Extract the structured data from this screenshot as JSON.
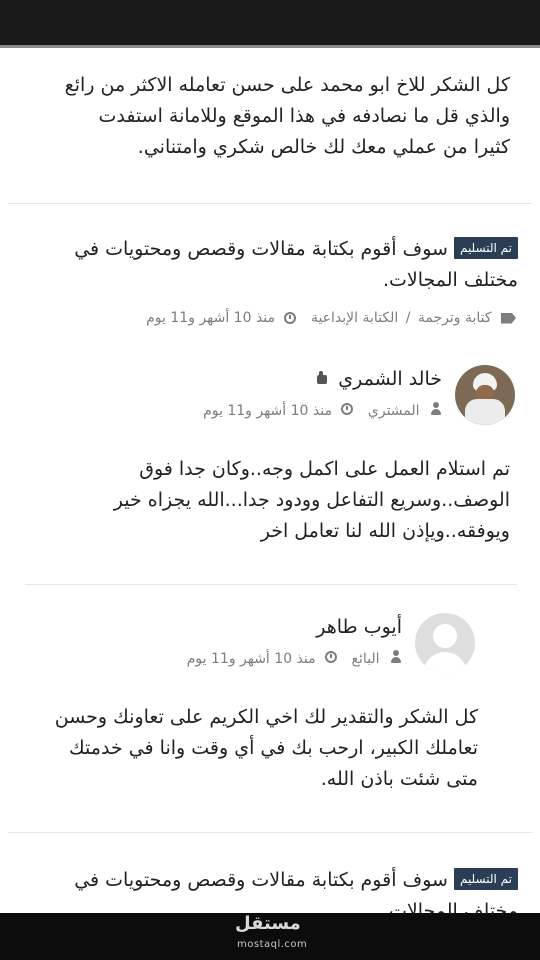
{
  "review_1": {
    "lines": [
      "كل الشكر للاخ ابو محمد على حسن تعامله الاكثر من رائع",
      "والذي قل ما نصادفه في هذا الموقع وللامانة استفدت",
      "كثيرا من عملي معك لك خالص شكري وامتناني."
    ]
  },
  "project_1": {
    "badge": "تم التسليم",
    "title_line1": "سوف أقوم بكتابة مقالات وقصص ومحتويات في",
    "title_line2": "مختلف المجالات.",
    "category": "كتابة وترجمة",
    "subcategory": "الكتابة الإبداعية",
    "separator": "/",
    "time": "منذ 10 أشهر و11 يوم"
  },
  "buyer": {
    "name": "خالد الشمري",
    "role": "المشتري",
    "time": "منذ 10 أشهر و11 يوم",
    "comment_lines": [
      "تم استلام العمل على اكمل وجه..وكان جدا فوق",
      "الوصف..وسريع التفاعل وودود جدا...الله يجزاه خير",
      "ويوفقه..ويإذن الله لنا تعامل اخر"
    ]
  },
  "seller": {
    "name": "أيوب طاهر",
    "role": "البائع",
    "time": "منذ 10 أشهر و11 يوم",
    "comment_lines": [
      "كل الشكر والتقدير لك اخي الكريم على تعاونك وحسن",
      "تعاملك الكبير، ارحب بك في أي وقت وانا في خدمتك",
      "متى شئت باذن الله."
    ]
  },
  "project_2": {
    "badge": "تم التسليم",
    "title_line1": "سوف أقوم بكتابة مقالات وقصص ومحتويات في",
    "title_line2": "مختلف المجالات."
  },
  "watermark": {
    "arabic": "مستقل",
    "latin": "mostaql.com"
  },
  "icons": {
    "tag": "tag-icon",
    "clock": "clock-icon",
    "user": "user-icon",
    "thumbs_up": "thumbs-up-icon"
  },
  "colors": {
    "badge_bg": "#2b3e55",
    "meta_text": "#7d7d7d",
    "body_text": "#222222"
  }
}
